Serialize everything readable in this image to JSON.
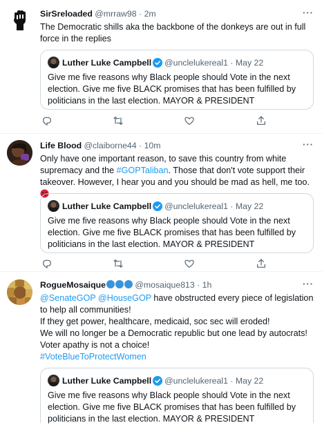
{
  "tweets": [
    {
      "name": "SirSreloaded",
      "handle": "@mrraw98",
      "dot": "·",
      "time": "2m",
      "more": "···",
      "text": "The Democratic shills aka the backbone of the donkeys are out in full force in the replies",
      "quote": {
        "name": "Luther Luke Campbell",
        "handle": "@unclelukereal1",
        "dot": "·",
        "time": "May 22",
        "text": "Give me five reasons why Black people should Vote in the next election. Give me five BLACK promises that has been fulfilled by politicians in the last election. MAYOR & PRESIDENT"
      }
    },
    {
      "name": "Life Blood",
      "handle": "@claiborne44",
      "dot": "·",
      "time": "10m",
      "more": "···",
      "text_part1": "Only have one important reason, to save this country from white supremacy and the ",
      "hashtag": "#GOPTaliban",
      "text_part2": ". Those that don't vote support their takeover. However, I hear you and you should be mad as hell, me too. ",
      "quote": {
        "name": "Luther Luke Campbell",
        "handle": "@unclelukereal1",
        "dot": "·",
        "time": "May 22",
        "text": "Give me five reasons why Black people should Vote in the next election. Give me five BLACK promises that has been fulfilled by politicians in the last election. MAYOR & PRESIDENT"
      }
    },
    {
      "name": "RogueMosaique",
      "handle": "@mosaique813",
      "dot": "·",
      "time": "1h",
      "more": "···",
      "mention1": "@SenateGOP",
      "mention2": "@HouseGOP",
      "line1_rest": " have obstructed every piece of legislation to help all communities!",
      "line2": "If they get power, healthcare, medicaid, soc sec will eroded!",
      "line3": "We will no longer be a Democratic republic but one lead by autocrats!",
      "line4": "Voter apathy is not a choice!",
      "hashtag": "#VoteBlueToProtectWomen",
      "quote": {
        "name": "Luther Luke Campbell",
        "handle": "@unclelukereal1",
        "dot": "·",
        "time": "May 22",
        "text": "Give me five reasons why Black people should Vote in the next election. Give me five BLACK promises that has been fulfilled by politicians in the last election. MAYOR & PRESIDENT"
      }
    }
  ],
  "colors": {
    "accent": "#1d9bf0",
    "secondary_text": "#536471",
    "border": "#cfd9de"
  },
  "icons": [
    "reply-icon",
    "retweet-icon",
    "like-icon",
    "share-icon",
    "verified-badge-icon",
    "more-icon"
  ]
}
